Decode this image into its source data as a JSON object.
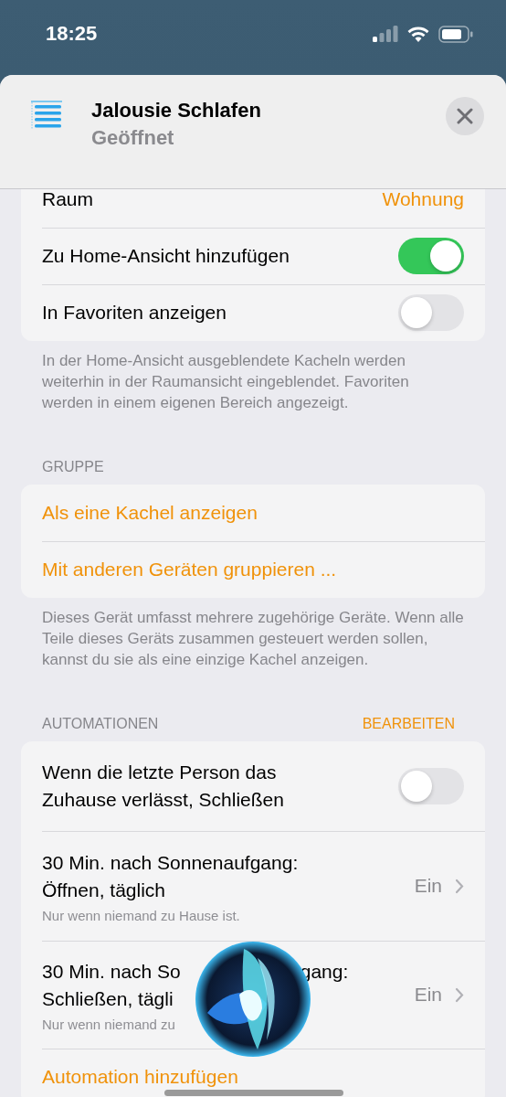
{
  "status_bar": {
    "time": "18:25"
  },
  "header": {
    "title": "Jalousie Schlafen",
    "subtitle": "Geöffnet"
  },
  "settings": [
    {
      "kind": "value",
      "label": "Raum",
      "value": "Wohnung"
    },
    {
      "kind": "toggle",
      "label": "Zu Home-Ansicht hinzufügen",
      "on": true
    },
    {
      "kind": "toggle",
      "label": "In Favoriten anzeigen",
      "on": false
    }
  ],
  "settings_footer": "In der Home-Ansicht ausgeblendete Kacheln werden weiterhin in der Raumansicht eingeblendet. Favoriten werden in einem eigenen Bereich angezeigt.",
  "group": {
    "header": "GRUPPE",
    "actions": [
      "Als eine Kachel anzeigen",
      "Mit anderen Geräten gruppieren ..."
    ],
    "footer": "Dieses Gerät umfasst mehrere zugehörige Geräte. Wenn alle Teile dieses Geräts zusammen gesteuert werden sollen, kannst du sie als eine einzige Kachel anzeigen."
  },
  "automations": {
    "header": "AUTOMATIONEN",
    "edit": "BEARBEITEN",
    "items": [
      {
        "kind": "toggle",
        "title_lines": [
          "Wenn die letzte Person das",
          "Zuhause verlässt, Schließen"
        ],
        "on": false
      },
      {
        "kind": "detail",
        "title_lines": [
          "30 Min. nach Sonnenaufgang:",
          "Öffnen, täglich"
        ],
        "note": "Nur wenn niemand zu Hause ist.",
        "value": "Ein"
      },
      {
        "kind": "covered",
        "title_parts": [
          "30 Min. nach So",
          "gang:"
        ],
        "title_line2": "Schließen, tägli",
        "note": "Nur wenn niemand zu",
        "value": "Ein"
      }
    ],
    "add": "Automation hinzufügen"
  }
}
